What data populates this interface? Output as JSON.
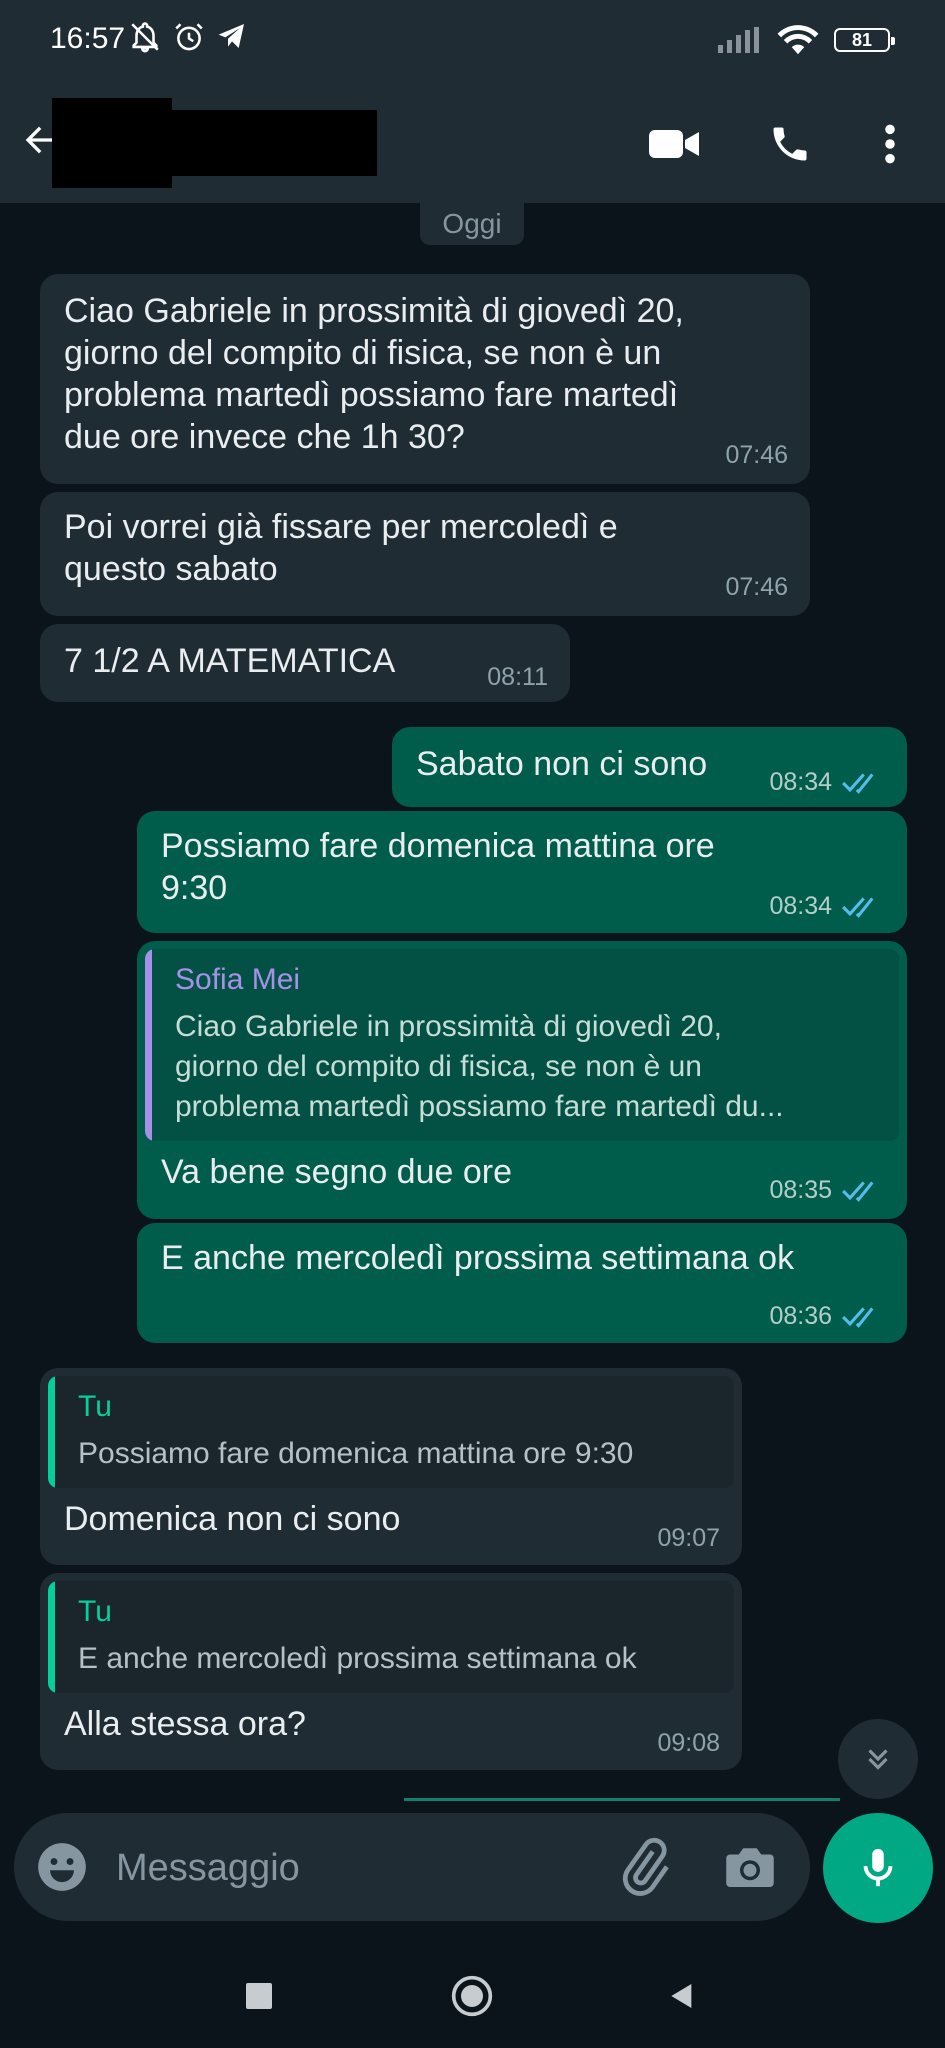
{
  "status_bar": {
    "time": "16:57",
    "battery": "81"
  },
  "header": {
    "contact_name": ""
  },
  "date_chip": "Oggi",
  "messages": [
    {
      "dir": "in",
      "text": "Ciao Gabriele in prossimità di giovedì 20,\ngiorno del compito di fisica, se non è un\nproblema martedì possiamo fare martedì\ndue ore invece che 1h 30?",
      "time": "07:46"
    },
    {
      "dir": "in",
      "text": "Poi vorrei già fissare per mercoledì e\nquesto sabato",
      "time": "07:46"
    },
    {
      "dir": "in",
      "text": "7 1/2 A MATEMATICA",
      "time": "08:11"
    },
    {
      "dir": "out",
      "text": "Sabato non ci sono",
      "time": "08:34"
    },
    {
      "dir": "out",
      "text": "Possiamo fare domenica mattina ore\n9:30",
      "time": "08:34"
    },
    {
      "dir": "out",
      "quote_name": "Sofia Mei",
      "quote_text": "Ciao Gabriele in prossimità di giovedì 20,\ngiorno del compito di fisica, se non è un\nproblema martedì possiamo fare martedì du...",
      "text": "Va bene segno due ore",
      "time": "08:35"
    },
    {
      "dir": "out",
      "text": "E anche mercoledì prossima settimana ok",
      "time": "08:36"
    },
    {
      "dir": "in",
      "quote_name": "Tu",
      "quote_text": "Possiamo fare domenica mattina ore 9:30",
      "text": "Domenica non ci sono",
      "time": "09:07"
    },
    {
      "dir": "in",
      "quote_name": "Tu",
      "quote_text": "E anche mercoledì prossima settimana ok",
      "text": "Alla stessa ora?",
      "time": "09:08"
    }
  ],
  "composer": {
    "placeholder": "Messaggio"
  },
  "colors": {
    "incoming_bubble": "#1f2c34",
    "outgoing_bubble": "#005c4b",
    "read_ticks": "#53bdeb",
    "quote_sofia": "#a791e8",
    "quote_tu": "#06cf9c",
    "accent": "#00a884"
  },
  "icons": [
    "back-arrow-icon",
    "video-call-icon",
    "phone-icon",
    "more-vert-icon",
    "emoji-icon",
    "attach-icon",
    "camera-icon",
    "mic-icon",
    "double-chevron-down-icon"
  ]
}
